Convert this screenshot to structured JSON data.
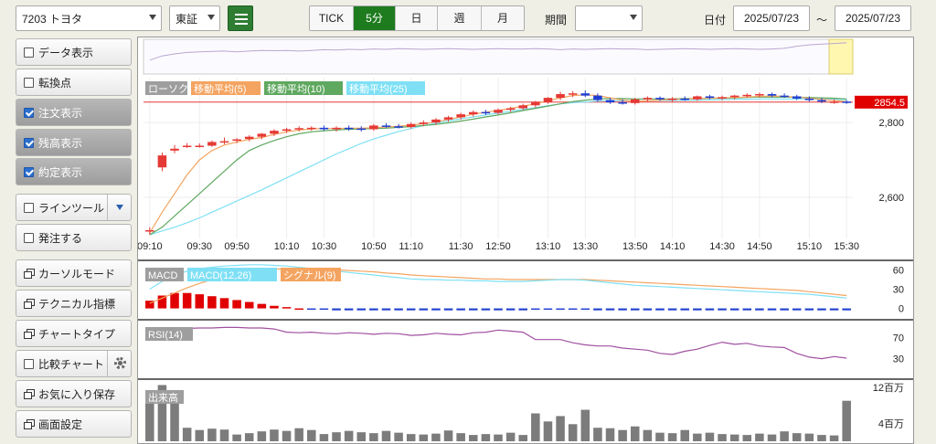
{
  "toolbar": {
    "symbol": "7203 トヨタ",
    "market": "東証",
    "intervals": [
      {
        "label": "TICK",
        "active": false
      },
      {
        "label": "5分",
        "active": true
      },
      {
        "label": "日",
        "active": false
      },
      {
        "label": "週",
        "active": false
      },
      {
        "label": "月",
        "active": false
      }
    ],
    "period_label": "期間",
    "period_value": "",
    "date_label": "日付",
    "date_from": "2025/07/23",
    "range_sep": "～",
    "date_to": "2025/07/23"
  },
  "sidebar": {
    "items": [
      {
        "label": "データ表示",
        "kind": "check",
        "checked": false
      },
      {
        "label": "転換点",
        "kind": "check",
        "checked": false
      },
      {
        "label": "注文表示",
        "kind": "check",
        "checked": true
      },
      {
        "label": "残高表示",
        "kind": "check",
        "checked": true
      },
      {
        "label": "約定表示",
        "kind": "check",
        "checked": true
      },
      {
        "label": "ラインツール",
        "kind": "check-dropdown",
        "checked": false
      },
      {
        "label": "発注する",
        "kind": "check",
        "checked": false
      },
      {
        "label": "カーソルモード",
        "kind": "window",
        "checked": false
      },
      {
        "label": "テクニカル指標",
        "kind": "window",
        "checked": false
      },
      {
        "label": "チャートタイプ",
        "kind": "window",
        "checked": false
      },
      {
        "label": "比較チャート",
        "kind": "check-gear",
        "checked": false
      },
      {
        "label": "お気に入り保存",
        "kind": "window",
        "checked": false
      },
      {
        "label": "画面設定",
        "kind": "window",
        "checked": false
      }
    ]
  },
  "chart_data": {
    "type": "candlestick",
    "price_panel": {
      "legend": [
        {
          "name": "ローソク",
          "color": "#9e9e9e"
        },
        {
          "name": "移動平均(5)",
          "color": "#f4a460"
        },
        {
          "name": "移動平均(10)",
          "color": "#5fa85f"
        },
        {
          "name": "移動平均(25)",
          "color": "#7fe0f5"
        }
      ],
      "ylim": [
        2490,
        2920
      ],
      "yticks": [
        {
          "value": 2600,
          "label": "2,600"
        },
        {
          "value": 2800,
          "label": "2,800"
        }
      ],
      "current_price": 2854.5,
      "current_price_label": "2854.5",
      "xticks": [
        "09:10",
        "09:30",
        "09:50",
        "10:10",
        "10:30",
        "10:50",
        "11:10",
        "11:30",
        "12:50",
        "13:10",
        "13:30",
        "13:50",
        "14:10",
        "14:30",
        "14:50",
        "15:10",
        "15:30"
      ],
      "candles": [
        {
          "o": 2510,
          "h": 2520,
          "l": 2500,
          "c": 2512
        },
        {
          "o": 2680,
          "h": 2720,
          "l": 2670,
          "c": 2712
        },
        {
          "o": 2725,
          "h": 2740,
          "l": 2718,
          "c": 2730
        },
        {
          "o": 2738,
          "h": 2745,
          "l": 2732,
          "c": 2738
        },
        {
          "o": 2738,
          "h": 2744,
          "l": 2733,
          "c": 2738
        },
        {
          "o": 2738,
          "h": 2752,
          "l": 2735,
          "c": 2748
        },
        {
          "o": 2748,
          "h": 2760,
          "l": 2742,
          "c": 2750
        },
        {
          "o": 2752,
          "h": 2758,
          "l": 2745,
          "c": 2755
        },
        {
          "o": 2756,
          "h": 2766,
          "l": 2750,
          "c": 2762
        },
        {
          "o": 2762,
          "h": 2772,
          "l": 2755,
          "c": 2770
        },
        {
          "o": 2770,
          "h": 2782,
          "l": 2764,
          "c": 2778
        },
        {
          "o": 2778,
          "h": 2786,
          "l": 2772,
          "c": 2782
        },
        {
          "o": 2782,
          "h": 2790,
          "l": 2776,
          "c": 2785
        },
        {
          "o": 2785,
          "h": 2790,
          "l": 2778,
          "c": 2786
        },
        {
          "o": 2786,
          "h": 2792,
          "l": 2778,
          "c": 2782
        },
        {
          "o": 2782,
          "h": 2790,
          "l": 2776,
          "c": 2786
        },
        {
          "o": 2786,
          "h": 2792,
          "l": 2778,
          "c": 2784
        },
        {
          "o": 2784,
          "h": 2790,
          "l": 2776,
          "c": 2782
        },
        {
          "o": 2782,
          "h": 2796,
          "l": 2778,
          "c": 2792
        },
        {
          "o": 2792,
          "h": 2798,
          "l": 2786,
          "c": 2790
        },
        {
          "o": 2790,
          "h": 2796,
          "l": 2784,
          "c": 2788
        },
        {
          "o": 2788,
          "h": 2800,
          "l": 2784,
          "c": 2796
        },
        {
          "o": 2796,
          "h": 2806,
          "l": 2790,
          "c": 2800
        },
        {
          "o": 2800,
          "h": 2812,
          "l": 2794,
          "c": 2808
        },
        {
          "o": 2808,
          "h": 2818,
          "l": 2802,
          "c": 2814
        },
        {
          "o": 2814,
          "h": 2826,
          "l": 2808,
          "c": 2822
        },
        {
          "o": 2822,
          "h": 2832,
          "l": 2816,
          "c": 2828
        },
        {
          "o": 2828,
          "h": 2834,
          "l": 2820,
          "c": 2826
        },
        {
          "o": 2826,
          "h": 2838,
          "l": 2822,
          "c": 2834
        },
        {
          "o": 2834,
          "h": 2842,
          "l": 2828,
          "c": 2838
        },
        {
          "o": 2838,
          "h": 2850,
          "l": 2834,
          "c": 2846
        },
        {
          "o": 2846,
          "h": 2858,
          "l": 2840,
          "c": 2854
        },
        {
          "o": 2854,
          "h": 2868,
          "l": 2850,
          "c": 2866
        },
        {
          "o": 2866,
          "h": 2882,
          "l": 2860,
          "c": 2876
        },
        {
          "o": 2876,
          "h": 2884,
          "l": 2868,
          "c": 2878
        },
        {
          "o": 2878,
          "h": 2886,
          "l": 2868,
          "c": 2872
        },
        {
          "o": 2872,
          "h": 2878,
          "l": 2856,
          "c": 2860
        },
        {
          "o": 2860,
          "h": 2866,
          "l": 2850,
          "c": 2854
        },
        {
          "o": 2854,
          "h": 2862,
          "l": 2848,
          "c": 2852
        },
        {
          "o": 2852,
          "h": 2866,
          "l": 2848,
          "c": 2862
        },
        {
          "o": 2862,
          "h": 2870,
          "l": 2856,
          "c": 2866
        },
        {
          "o": 2866,
          "h": 2870,
          "l": 2858,
          "c": 2862
        },
        {
          "o": 2862,
          "h": 2868,
          "l": 2856,
          "c": 2864
        },
        {
          "o": 2864,
          "h": 2870,
          "l": 2858,
          "c": 2862
        },
        {
          "o": 2862,
          "h": 2872,
          "l": 2858,
          "c": 2870
        },
        {
          "o": 2870,
          "h": 2874,
          "l": 2862,
          "c": 2866
        },
        {
          "o": 2866,
          "h": 2872,
          "l": 2860,
          "c": 2868
        },
        {
          "o": 2868,
          "h": 2874,
          "l": 2862,
          "c": 2872
        },
        {
          "o": 2872,
          "h": 2878,
          "l": 2866,
          "c": 2874
        },
        {
          "o": 2874,
          "h": 2880,
          "l": 2868,
          "c": 2876
        },
        {
          "o": 2876,
          "h": 2880,
          "l": 2868,
          "c": 2872
        },
        {
          "o": 2872,
          "h": 2878,
          "l": 2866,
          "c": 2870
        },
        {
          "o": 2870,
          "h": 2874,
          "l": 2860,
          "c": 2864
        },
        {
          "o": 2864,
          "h": 2870,
          "l": 2856,
          "c": 2860
        },
        {
          "o": 2860,
          "h": 2866,
          "l": 2852,
          "c": 2856
        },
        {
          "o": 2856,
          "h": 2862,
          "l": 2850,
          "c": 2856
        },
        {
          "o": 2856,
          "h": 2860,
          "l": 2850,
          "c": 2854
        }
      ],
      "ma5": [
        2505,
        2560,
        2610,
        2660,
        2700,
        2725,
        2740,
        2748,
        2755,
        2760,
        2768,
        2775,
        2780,
        2783,
        2784,
        2784,
        2785,
        2785,
        2786,
        2788,
        2790,
        2793,
        2797,
        2802,
        2808,
        2815,
        2822,
        2828,
        2832,
        2838,
        2844,
        2850,
        2858,
        2866,
        2872,
        2874,
        2872,
        2866,
        2860,
        2857,
        2858,
        2860,
        2862,
        2863,
        2864,
        2865,
        2866,
        2867,
        2868,
        2870,
        2871,
        2870,
        2868,
        2865,
        2862,
        2859,
        2856
      ],
      "ma10": [
        2500,
        2520,
        2550,
        2580,
        2610,
        2640,
        2670,
        2700,
        2725,
        2740,
        2752,
        2762,
        2770,
        2775,
        2778,
        2780,
        2782,
        2783,
        2784,
        2785,
        2787,
        2789,
        2792,
        2795,
        2799,
        2804,
        2809,
        2815,
        2820,
        2826,
        2832,
        2838,
        2844,
        2850,
        2856,
        2860,
        2863,
        2864,
        2864,
        2863,
        2863,
        2863,
        2863,
        2864,
        2864,
        2865,
        2865,
        2866,
        2867,
        2868,
        2868,
        2868,
        2868,
        2867,
        2866,
        2865,
        2863
      ],
      "ma25": [
        2500,
        2510,
        2520,
        2532,
        2545,
        2560,
        2575,
        2590,
        2605,
        2620,
        2636,
        2652,
        2668,
        2684,
        2700,
        2716,
        2730,
        2744,
        2756,
        2766,
        2776,
        2784,
        2792,
        2798,
        2804,
        2810,
        2815,
        2820,
        2825,
        2830,
        2835,
        2840,
        2845,
        2850,
        2853,
        2855,
        2857,
        2858,
        2858,
        2858,
        2858,
        2859,
        2859,
        2860,
        2860,
        2861,
        2861,
        2862,
        2862,
        2863,
        2863,
        2863,
        2863,
        2863,
        2862,
        2862,
        2861
      ]
    },
    "macd_panel": {
      "legend": [
        {
          "name": "MACD",
          "color": "#9e9e9e"
        },
        {
          "name": "MACD(12,26)",
          "color": "#7fe0f5"
        },
        {
          "name": "シグナル(9)",
          "color": "#f4a460"
        }
      ],
      "ylim": [
        -12,
        72
      ],
      "yticks": [
        {
          "value": 60,
          "label": "60"
        },
        {
          "value": 30,
          "label": "30"
        },
        {
          "value": 0,
          "label": "0"
        }
      ],
      "macd": [
        30,
        42,
        52,
        58,
        62,
        64,
        66,
        67,
        68,
        68,
        67,
        66,
        64,
        62,
        60,
        58,
        56,
        54,
        52,
        50,
        48,
        46,
        45,
        45,
        44,
        44,
        43,
        43,
        42,
        42,
        42,
        43,
        44,
        45,
        45,
        44,
        42,
        40,
        38,
        36,
        35,
        34,
        33,
        32,
        31,
        30,
        29,
        28,
        27,
        26,
        25,
        24,
        23,
        22,
        20,
        18,
        16
      ],
      "signal": [
        8,
        16,
        24,
        32,
        39,
        45,
        50,
        54,
        57,
        59,
        61,
        62,
        62,
        62,
        61,
        60,
        59,
        58,
        57,
        55,
        54,
        52,
        51,
        50,
        49,
        48,
        47,
        46,
        46,
        45,
        45,
        45,
        45,
        45,
        45,
        45,
        44,
        43,
        42,
        41,
        40,
        39,
        38,
        37,
        36,
        35,
        34,
        33,
        32,
        31,
        30,
        29,
        28,
        26,
        24,
        22,
        20
      ],
      "histogram": [
        12,
        20,
        24,
        24,
        22,
        19,
        16,
        13,
        10,
        7,
        4,
        2,
        0,
        -1,
        -2,
        -3,
        -3,
        -3,
        -3,
        -3,
        -3,
        -3,
        -3,
        -3,
        -3,
        -3,
        -3,
        -3,
        -3,
        -3,
        -3,
        -2,
        -2,
        -2,
        -2,
        -2,
        -3,
        -3,
        -3,
        -3,
        -3,
        -3,
        -3,
        -3,
        -3,
        -3,
        -3,
        -3,
        -3,
        -3,
        -3,
        -3,
        -3,
        -3,
        -3,
        -3,
        -3
      ]
    },
    "rsi_panel": {
      "legend": [
        {
          "name": "RSI(14)",
          "color": "#a050a0"
        }
      ],
      "ylim": [
        0,
        100
      ],
      "yticks": [
        {
          "value": 70,
          "label": "70"
        },
        {
          "value": 30,
          "label": "30"
        }
      ],
      "rsi": [
        82,
        86,
        87,
        87,
        88,
        88,
        89,
        89,
        88,
        88,
        86,
        80,
        79,
        80,
        78,
        77,
        79,
        78,
        76,
        78,
        77,
        74,
        75,
        78,
        76,
        75,
        79,
        80,
        84,
        82,
        80,
        66,
        66,
        66,
        60,
        56,
        54,
        54,
        50,
        48,
        46,
        40,
        38,
        44,
        48,
        55,
        61,
        57,
        59,
        54,
        52,
        51,
        40,
        33,
        30,
        34,
        31
      ]
    },
    "volume_panel": {
      "legend": [
        {
          "name": "出来高",
          "color": "#9e9e9e"
        }
      ],
      "ylim": [
        0,
        13
      ],
      "yticks": [
        {
          "value": 12,
          "label": "12百万"
        },
        {
          "value": 4,
          "label": "4百万"
        }
      ],
      "volume": [
        11,
        12.5,
        10.5,
        3,
        2.5,
        2.8,
        2.6,
        1.5,
        1.8,
        2.2,
        2.6,
        2.3,
        2.9,
        2.5,
        1.6,
        2.0,
        2.3,
        2.0,
        1.8,
        2.3,
        1.9,
        1.6,
        1.5,
        1.7,
        2.4,
        1.8,
        1.4,
        1.6,
        1.5,
        1.9,
        1.4,
        6.2,
        4.4,
        5.6,
        3.8,
        7.0,
        3.0,
        2.9,
        2.5,
        3.3,
        2.5,
        1.9,
        1.8,
        2.5,
        1.7,
        1.9,
        1.6,
        1.5,
        1.4,
        1.7,
        1.5,
        2.2,
        1.8,
        1.7,
        1.4,
        1.3,
        9.0
      ]
    },
    "navigator": {
      "overview": [
        0.4,
        0.52,
        0.58,
        0.62,
        0.64,
        0.65,
        0.66,
        0.64,
        0.66,
        0.68,
        0.67,
        0.68,
        0.66,
        0.68,
        0.7,
        0.69,
        0.71,
        0.7,
        0.72,
        0.71,
        0.73,
        0.72,
        0.71,
        0.72,
        0.73,
        0.72,
        0.71,
        0.72,
        0.73,
        0.72,
        0.72,
        0.73,
        0.72,
        0.7,
        0.72,
        0.71,
        0.72,
        0.73,
        0.72,
        0.72,
        0.7,
        0.71,
        0.72,
        0.73,
        0.72,
        0.71,
        0.72,
        0.73,
        0.72,
        0.71,
        0.72,
        0.74,
        0.8,
        0.84,
        0.86,
        0.88,
        0.9
      ]
    }
  }
}
